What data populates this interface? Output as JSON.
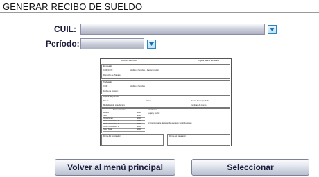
{
  "header": {
    "title": "GENERAR RECIBO DE SUELDO"
  },
  "form": {
    "cuil_label": "CUIL:",
    "periodo_label": "Período:",
    "cuil_value": "",
    "periodo_value": ""
  },
  "receipt": {
    "title": "RECIBO DE PAGO",
    "copy_label": "Original para el Empleado",
    "empleador": "Empleador",
    "cuit": "CUIL/CUIT:",
    "razon": "Apellido y Nombre o Denominación",
    "domicilio": "Domicilio de Trabajo:",
    "trabajador": "Trabajador",
    "cuil": "CUIL:",
    "apellido": "Apellido y Nombre",
    "fecha_ingreso": "Fecha de Ingreso:",
    "detalle": "Detalle del período",
    "desde": "Desde",
    "hasta": "Hasta",
    "puesto": "Puesto Desempeñado",
    "modalidad": "Modalidad de Liquidación:",
    "cantidad_horas": "Cantidad de Horas",
    "remuneracion": "Remuneración",
    "sin_pesos": "Son Pesos:",
    "lugar_fecha": "Lugar y Fecha:",
    "comprobante": "El Comprobante de pago de aportes y contribuciones",
    "rows": [
      {
        "label": "Básico",
        "value": "$0,00"
      },
      {
        "label": "SAC",
        "value": "$0,00"
      },
      {
        "label": "Vacaciones",
        "value": "$0,00"
      },
      {
        "label": "Otros Conceptos 1",
        "value": "$0,00"
      },
      {
        "label": "Otros Conceptos 2",
        "value": "$0,00"
      },
      {
        "label": "Otros Conceptos 3",
        "value": "$0,00"
      },
      {
        "label": "Neto Total",
        "value": "$0,00"
      }
    ],
    "firma_empleador": "Firma del empleador",
    "firma_trabajador": "Firma del trabajador"
  },
  "buttons": {
    "back_label": "Volver al menú principal",
    "select_label": "Seleccionar"
  },
  "colors": {
    "accent": "#2e86c1",
    "field_fill": "#c9ccd8",
    "label_text": "#1a1a3a"
  }
}
